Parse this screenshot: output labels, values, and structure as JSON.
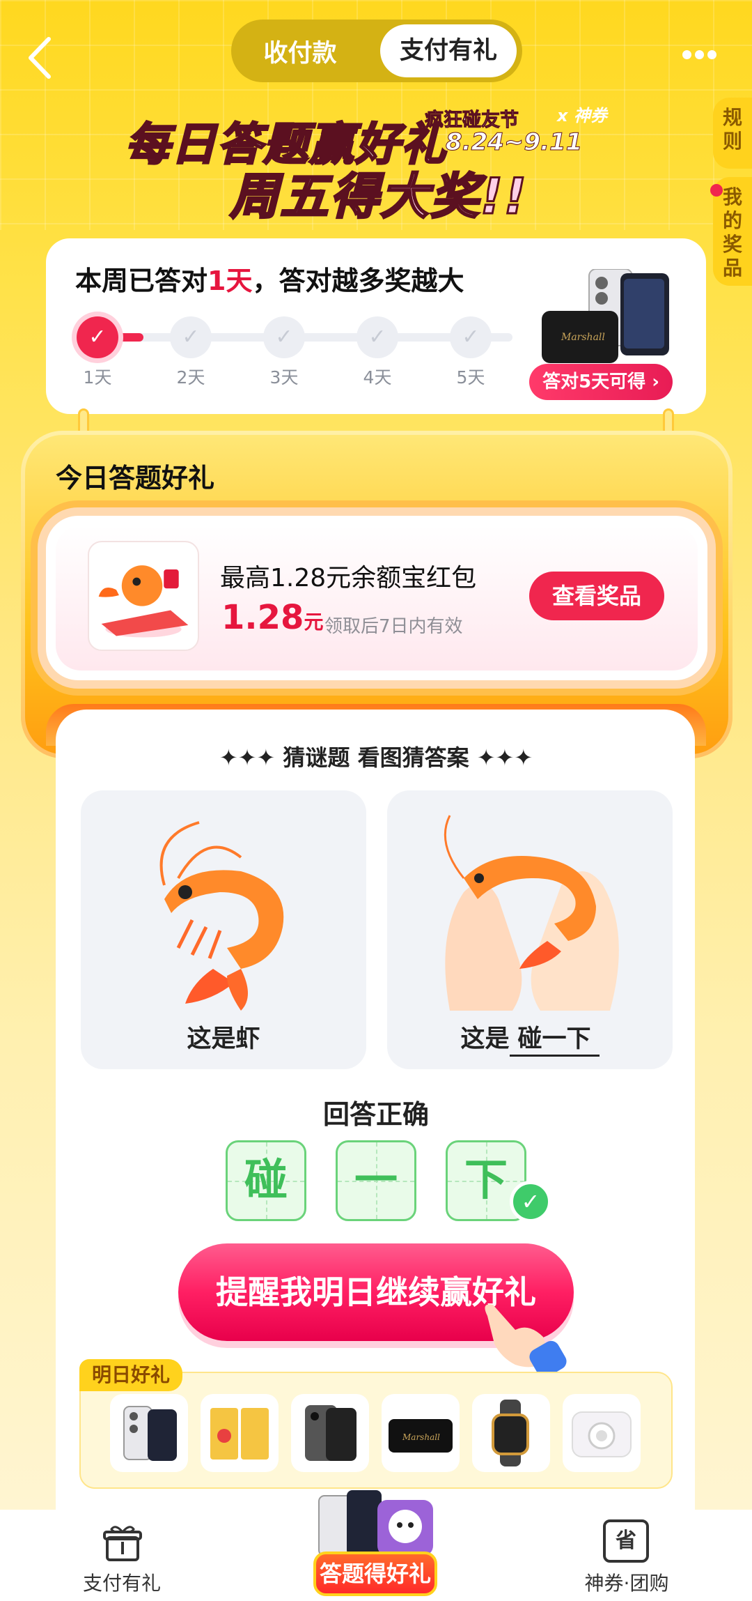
{
  "header": {
    "tabs": [
      "收付款",
      "支付有礼"
    ],
    "active_tab": "支付有礼"
  },
  "side": {
    "rules": "规则",
    "my_prizes": "我的奖品"
  },
  "banner": {
    "line1": "每日答题赢好礼",
    "line2": "周五得大奖!!",
    "event": "疯狂碰友节",
    "event_tail": "x 神券",
    "dates": "8.24~9.11"
  },
  "progress": {
    "prefix": "本周已答对",
    "days": "1天",
    "suffix": "，答对越多奖越大",
    "labels": [
      "1天",
      "2天",
      "3天",
      "4天",
      "5天"
    ],
    "completed": 1,
    "prize_pill": "答对5天可得"
  },
  "gift": {
    "title": "今日答题好礼",
    "name": "最高1.28元余额宝红包",
    "amount": "1.28",
    "unit": "元",
    "validity": "领取后7日内有效",
    "button": "查看奖品"
  },
  "quiz": {
    "heading": "猜谜题 看图猜答案",
    "left_caption": "这是虾",
    "right_prefix": "这是",
    "right_answer": "碰一下",
    "result": "回答正确",
    "tiles": [
      "碰",
      "一",
      "下"
    ],
    "remind_button": "提醒我明日继续赢好礼"
  },
  "tomorrow": {
    "tag": "明日好礼",
    "items": [
      "phone-white-icon",
      "gold-card-icon",
      "phone-black-icon",
      "speaker-icon",
      "watch-icon",
      "camera-icon"
    ]
  },
  "nav": {
    "left": "支付有礼",
    "center": "答题得好礼",
    "right": "神券·团购",
    "right_icon_text": "省"
  },
  "colors": {
    "accent": "#f0264e",
    "yellow": "#ffd21d",
    "green": "#3fbf5a"
  }
}
